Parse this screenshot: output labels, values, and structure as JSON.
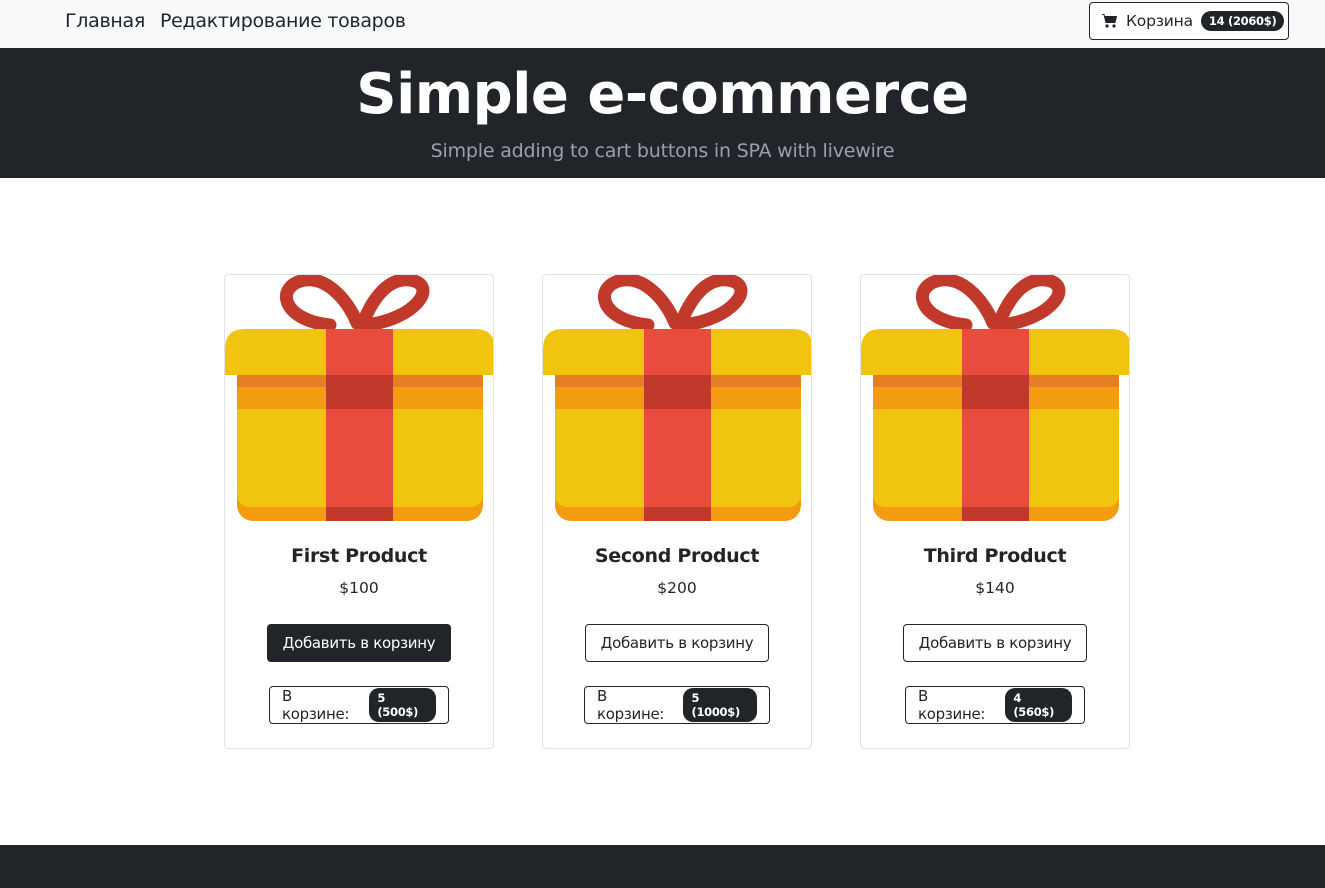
{
  "nav": {
    "home": "Главная",
    "edit_products": "Редактирование товаров",
    "cart_label": "Корзина",
    "cart_badge": "14 (2060$)"
  },
  "hero": {
    "title": "Simple e-commerce",
    "subtitle": "Simple adding to cart buttons in SPA with livewire"
  },
  "products": [
    {
      "name": "First Product",
      "price": "$100",
      "add_label": "Добавить в корзину",
      "in_cart_label": "В корзине:",
      "in_cart_badge": "5 (500$)"
    },
    {
      "name": "Second Product",
      "price": "$200",
      "add_label": "Добавить в корзину",
      "in_cart_label": "В корзине:",
      "in_cart_badge": "5 (1000$)"
    },
    {
      "name": "Third Product",
      "price": "$140",
      "add_label": "Добавить в корзину",
      "in_cart_label": "В корзине:",
      "in_cart_badge": "4 (560$)"
    }
  ],
  "colors": {
    "dark": "#212529",
    "gift_yellow": "#f1c40f",
    "gift_orange": "#f39c12",
    "ribbon_red": "#e74c3c",
    "ribbon_dark": "#c0392b"
  }
}
